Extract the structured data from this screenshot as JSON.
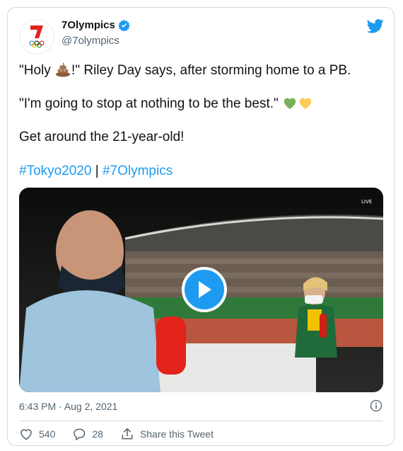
{
  "tweet": {
    "display_name": "7Olympics",
    "handle": "@7olympics",
    "line1_before": "\"Holy ",
    "line1_after": "!\" Riley Day says, after storming home to a PB.",
    "line2": "\"I'm going to stop at nothing to be the best.\"",
    "line3": "Get around the 21-year-old!",
    "hashtag1": "#Tokyo2020",
    "hashtag_sep": " | ",
    "hashtag2": "#7Olympics",
    "timestamp": "6:43 PM · Aug 2, 2021",
    "likes": "540",
    "replies": "28",
    "share_label": "Share this Tweet"
  },
  "colors": {
    "accent": "#1d9bf0",
    "text": "#0f1419",
    "muted": "#536471",
    "border": "#cfd9de"
  },
  "icons": [
    "seven-logo-icon",
    "verified-badge-icon",
    "twitter-bird-icon",
    "poop-emoji-icon",
    "green-heart-icon",
    "yellow-heart-icon",
    "play-icon",
    "info-icon",
    "heart-icon",
    "reply-icon",
    "share-icon"
  ]
}
